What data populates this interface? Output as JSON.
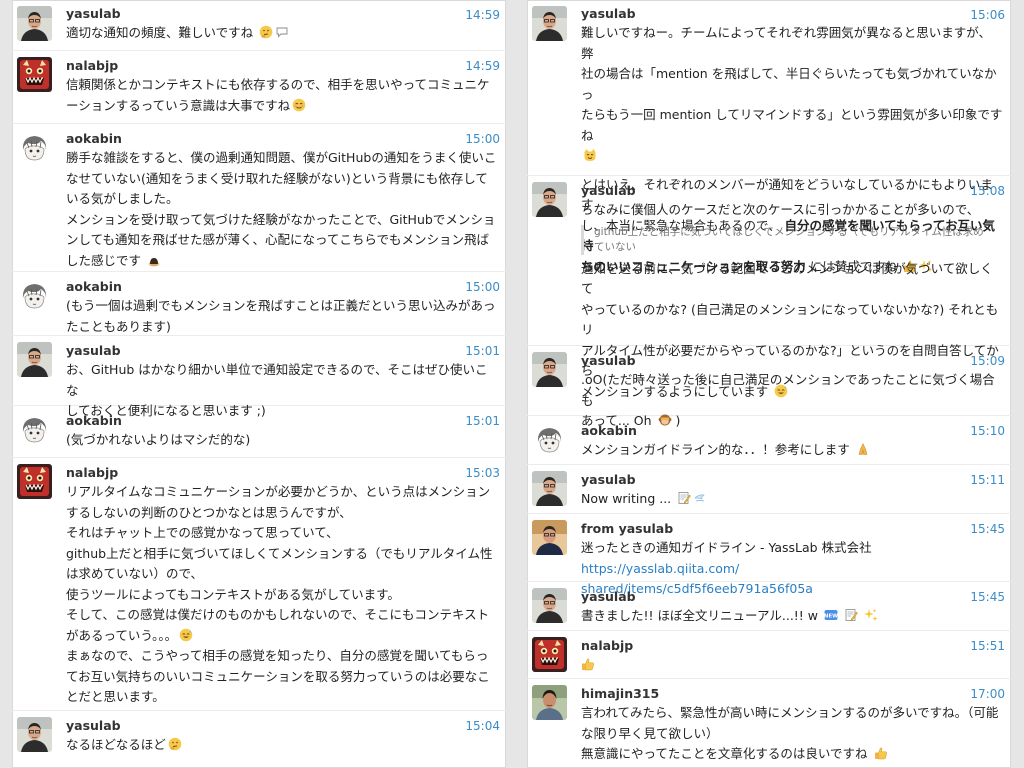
{
  "left": {
    "messages": [
      {
        "author": "yasulab",
        "time": "14:59",
        "lines": [
          "適切な通知の頻度、難しいですね"
        ]
      },
      {
        "author": "nalabjp",
        "time": "14:59",
        "lines": [
          "信頼関係とかコンテキストにも依存するので、相手を思いやってコミュニケ",
          "ーションするっていう意識は大事ですね"
        ]
      },
      {
        "author": "aokabin",
        "time": "15:00",
        "lines": [
          "勝手な雑談をすると、僕の過剰通知問題、僕がGitHubの通知をうまく使いこ",
          "なせていない(通知をうまく受け取れた経験がない)という背景にも依存して",
          "いる気がしました。",
          "メンションを受け取って気づけた経験がなかったことで、GitHubでメンショ",
          "ンしても通知を飛ばせた感が薄く、心配になってこちらでもメンション飛ば",
          "した感じです"
        ]
      },
      {
        "author": "aokabin",
        "time": "15:00",
        "lines": [
          "(もう一個は過剰でもメンションを飛ばすことは正義だという思い込みがあっ",
          "たこともあります)"
        ]
      },
      {
        "author": "yasulab",
        "time": "15:01",
        "lines": [
          "お、GitHub はかなり細かい単位で通知設定できるので、そこはぜひ使いこな",
          "しておくと便利になると思います ;)"
        ]
      },
      {
        "author": "aokabin",
        "time": "15:01",
        "lines": [
          "(気づかれないよりはマシだ的な)"
        ]
      },
      {
        "author": "nalabjp",
        "time": "15:03",
        "lines": [
          "リアルタイムなコミュニケーションが必要かどうか、という点はメンション",
          "するしないの判断のひとつかなとは思うんですが、",
          "それはチャット上での感覚かなって思っていて、",
          "github上だと相手に気づいてほしくてメンションする（でもリアルタイム性",
          "は求めていない）ので、",
          "使うツールによってもコンテキストがある気がしています。",
          "そして、この感覚は僕だけのものかもしれないので、そこにもコンテキスト",
          "があるっていう。。。",
          "まぁなので、こうやって相手の感覚を知ったり、自分の感覚を聞いてもらっ",
          "てお互い気持ちのいいコミュニケーションを取る努力っていうのは必要なこ",
          "とだと思います。"
        ]
      },
      {
        "author": "yasulab",
        "time": "15:04",
        "lines": [
          "なるほどなるほど"
        ]
      }
    ]
  },
  "right": {
    "m1": {
      "author": "yasulab",
      "time": "15:06",
      "para1": [
        "難しいですねー。チームによってそれぞれ雰囲気が異なると思いますが、弊",
        "社の場合は「mention を飛ばして、半日ぐらいたっても気づかれていなかっ",
        "たらもう一回 mention してリマインドする」という雰囲気が多い印象ですね"
      ],
      "para2_a": "とはいえ、それぞれのメンバーが通知をどういなしているかにもよりいます",
      "para2_b_plain": "し、本当に緊急な場合もあるので、",
      "para2_b_bold": "自分の感覚を聞いてもらってお互い気持",
      "para2_c_bold": "ちのいいコミュニケーションを取る努力",
      "para2_c_plain": " には賛成ですね"
    },
    "m2": {
      "author": "yasulab",
      "time": "15:08",
      "line1": "ちなみに僕個人のケースだと次のケースに引っかかることが多いので、",
      "quote": [
        "github上だと相手に気づいてほしくてメンションする（でもリアルタイム性は求め",
        "ていない"
      ],
      "rest": [
        "通知を送る前に、気づける範囲で「このメンションは僕が気づいて欲しくて",
        "やっているのかな? (自己満足のメンションになっていないかな?) それともリ",
        "アルタイム性が必要だからやっているのかな?」というのを自問自答してから",
        "メンションするようにしています"
      ]
    },
    "m3": {
      "author": "yasulab",
      "time": "15:09",
      "lines": [
        ".oO(ただ時々送った後に自己満足のメンションであったことに気づく場合も",
        "あって... Oh"
      ],
      "tail": ")"
    },
    "m4": {
      "author": "aokabin",
      "time": "15:10",
      "line": "メンションガイドライン的な．．！参考にします"
    },
    "m5": {
      "author": "yasulab",
      "time": "15:11",
      "line": "Now writing ..."
    },
    "m6": {
      "author": "from yasulab",
      "time": "15:45",
      "text": "迷ったときの通知ガイドライン - YassLab 株式会社 ",
      "link1": "https://yasslab.qiita.com/",
      "link2": "shared/items/c5df5f6eeb791a56f05a"
    },
    "m7": {
      "author": "yasulab",
      "time": "15:45",
      "line": "書きました!! ほぼ全文リニューアル...!! w"
    },
    "m8": {
      "author": "nalabjp",
      "time": "15:51"
    },
    "m9": {
      "author": "himajin315",
      "time": "17:00",
      "lines": [
        "言われてみたら、緊急性が高い時にメンションするのが多いですね。（可能",
        "な限り早く見て欲しい）",
        "無意識にやってたことを文章化するのは良いですね"
      ]
    }
  }
}
